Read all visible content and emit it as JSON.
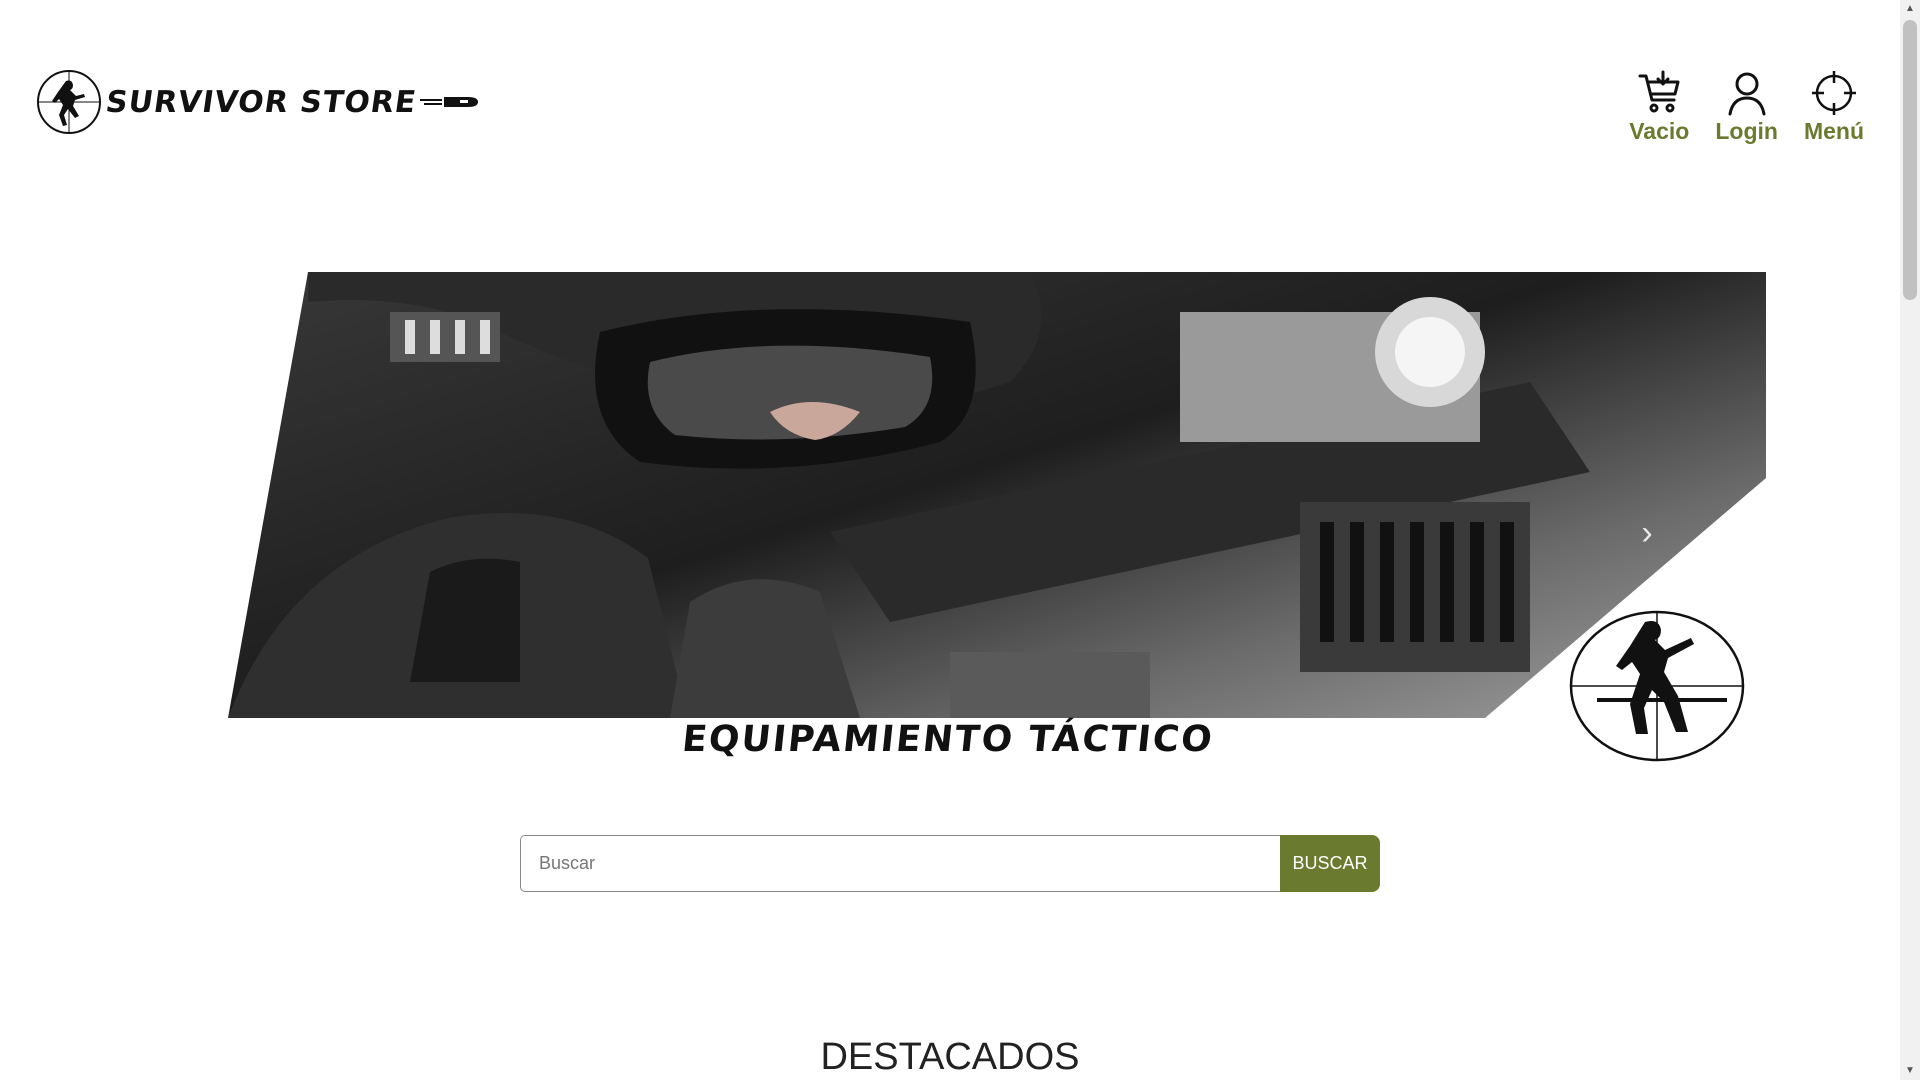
{
  "header": {
    "logo_text": "SURVIVOR STORE",
    "nav": {
      "cart_label": "Vacio",
      "login_label": "Login",
      "menu_label": "Menú"
    }
  },
  "hero": {
    "title": "EQUIPAMIENTO TÁCTICO",
    "next_arrow": "›"
  },
  "search": {
    "placeholder": "Buscar",
    "button_label": "BUSCAR"
  },
  "featured": {
    "title": "DESTACADOS"
  },
  "colors": {
    "accent": "#6a7a2e",
    "text": "#222222",
    "background": "#ffffff"
  },
  "icons": [
    "cart-icon",
    "user-icon",
    "crosshair-icon",
    "chevron-right-icon",
    "soldier-emblem-icon",
    "bullet-icon"
  ]
}
